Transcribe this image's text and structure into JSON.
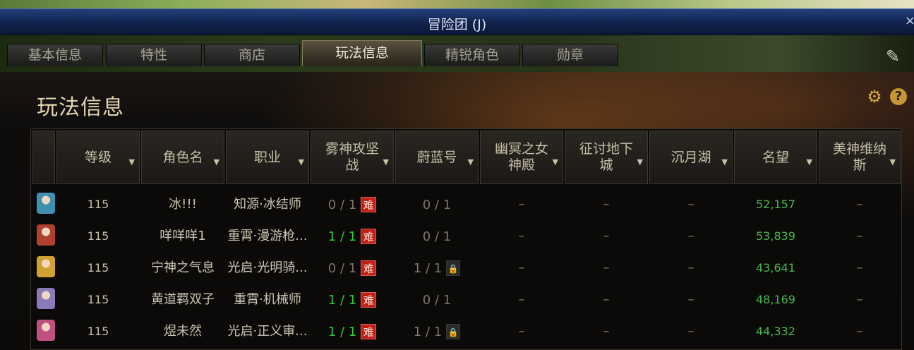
{
  "window": {
    "title": "冒险团 (J)",
    "close_glyph": "×"
  },
  "tabs": [
    "基本信息",
    "特性",
    "商店",
    "玩法信息",
    "精锐角色",
    "勋章"
  ],
  "active_tab": 3,
  "panel": {
    "title": "玩法信息"
  },
  "columns": [
    "",
    "等级",
    "角色名",
    "职业",
    "雾神攻坚战",
    "蔚蓝号",
    "幽冥之女神殿",
    "征讨地下城",
    "沉月湖",
    "名望",
    "美神维纳斯"
  ],
  "hard_badge": "难",
  "rows": [
    {
      "level": "115",
      "name": "冰!!!",
      "job": "知源·冰结师",
      "mist": "0 / 1",
      "mist_done": false,
      "azure": "0 / 1",
      "azure_locked": false,
      "temple": "–",
      "dungeon": "–",
      "lake": "–",
      "fame": "52,157",
      "venus": "–",
      "avatar_color": "#3f8fb0"
    },
    {
      "level": "115",
      "name": "咩咩咩1",
      "job": "重霄·漫游枪...",
      "mist": "1 / 1",
      "mist_done": true,
      "azure": "0 / 1",
      "azure_locked": false,
      "temple": "–",
      "dungeon": "–",
      "lake": "–",
      "fame": "53,839",
      "venus": "–",
      "avatar_color": "#b04030"
    },
    {
      "level": "115",
      "name": "宁神之气息",
      "job": "光启·光明骑...",
      "mist": "0 / 1",
      "mist_done": false,
      "azure": "1 / 1",
      "azure_locked": true,
      "temple": "–",
      "dungeon": "–",
      "lake": "–",
      "fame": "43,641",
      "venus": "–",
      "avatar_color": "#d0a030"
    },
    {
      "level": "115",
      "name": "黄道羁双子",
      "job": "重霄·机械师",
      "mist": "1 / 1",
      "mist_done": true,
      "azure": "0 / 1",
      "azure_locked": false,
      "temple": "–",
      "dungeon": "–",
      "lake": "–",
      "fame": "48,169",
      "venus": "–",
      "avatar_color": "#8a7ab8"
    },
    {
      "level": "115",
      "name": "煜未然",
      "job": "光启·正义审...",
      "mist": "1 / 1",
      "mist_done": true,
      "azure": "1 / 1",
      "azure_locked": true,
      "temple": "–",
      "dungeon": "–",
      "lake": "–",
      "fame": "44,332",
      "venus": "–",
      "avatar_color": "#c05080"
    }
  ],
  "colors": {
    "accent": "#d9a640",
    "hard": "#c0201a",
    "fame": "#45b84a",
    "done": "#34c83a"
  }
}
